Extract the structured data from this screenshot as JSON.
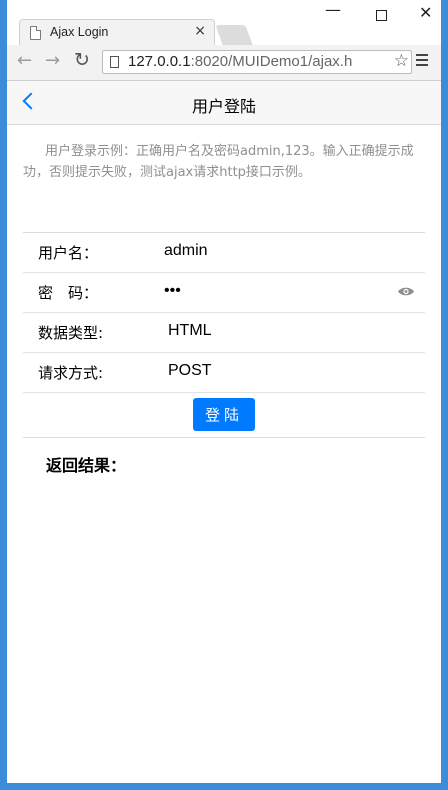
{
  "browser": {
    "tab_title": "Ajax Login",
    "tab_close": "×",
    "url_host": "127.0.0.1",
    "url_rest": ":8020/MUIDemo1/ajax.h",
    "window_controls": {
      "minimize": "—",
      "close": "✕"
    }
  },
  "header": {
    "title": "用户登陆",
    "back_icon": "chevron-left-icon"
  },
  "intro_text": "用户登录示例：正确用户名及密码admin,123。输入正确提示成功，否则提示失败，测试ajax请求http接口示例。",
  "form": {
    "username_label": "用户名：",
    "username_value": "admin",
    "password_label": "密　码：",
    "password_value": "•••",
    "datatype_label": "数据类型:",
    "datatype_value": "HTML",
    "method_label": "请求方式:",
    "method_value": "POST",
    "login_button": "登陆"
  },
  "result_label": "返回结果：",
  "colors": {
    "accent": "#007aff",
    "window_border": "#3c8cd9",
    "intro_text": "#8f8f94"
  }
}
